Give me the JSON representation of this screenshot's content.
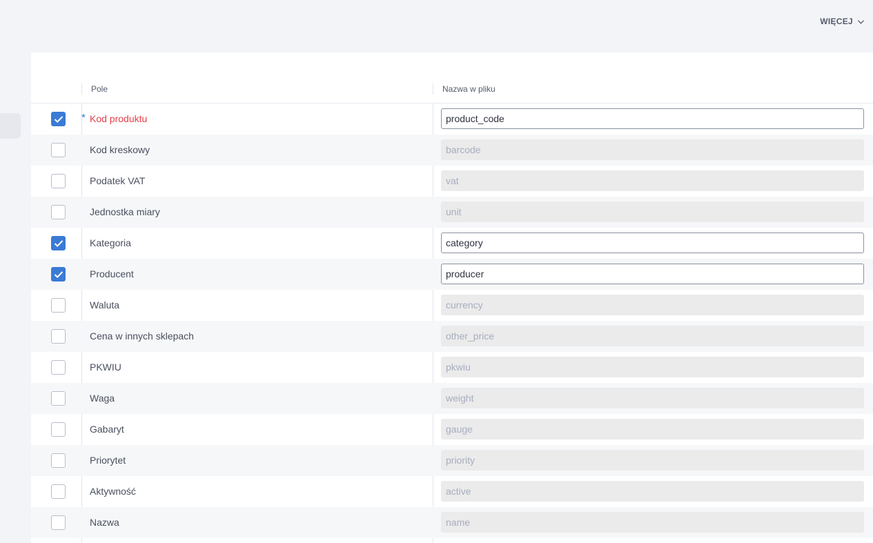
{
  "header": {
    "more_label": "WIĘCEJ",
    "more_icon": "chevron-down-icon"
  },
  "table": {
    "col_field": "Pole",
    "col_filename": "Nazwa w pliku",
    "rows": [
      {
        "label": "Kod produktu",
        "value": "product_code",
        "checked": true,
        "required": true
      },
      {
        "label": "Kod kreskowy",
        "value": "barcode",
        "checked": false,
        "required": false
      },
      {
        "label": "Podatek VAT",
        "value": "vat",
        "checked": false,
        "required": false
      },
      {
        "label": "Jednostka miary",
        "value": "unit",
        "checked": false,
        "required": false
      },
      {
        "label": "Kategoria",
        "value": "category",
        "checked": true,
        "required": false
      },
      {
        "label": "Producent",
        "value": "producer",
        "checked": true,
        "required": false
      },
      {
        "label": "Waluta",
        "value": "currency",
        "checked": false,
        "required": false
      },
      {
        "label": "Cena w innych sklepach",
        "value": "other_price",
        "checked": false,
        "required": false
      },
      {
        "label": "PKWIU",
        "value": "pkwiu",
        "checked": false,
        "required": false
      },
      {
        "label": "Waga",
        "value": "weight",
        "checked": false,
        "required": false
      },
      {
        "label": "Gabaryt",
        "value": "gauge",
        "checked": false,
        "required": false
      },
      {
        "label": "Priorytet",
        "value": "priority",
        "checked": false,
        "required": false
      },
      {
        "label": "Aktywność",
        "value": "active",
        "checked": false,
        "required": false
      },
      {
        "label": "Nazwa",
        "value": "name",
        "checked": false,
        "required": false
      }
    ]
  }
}
